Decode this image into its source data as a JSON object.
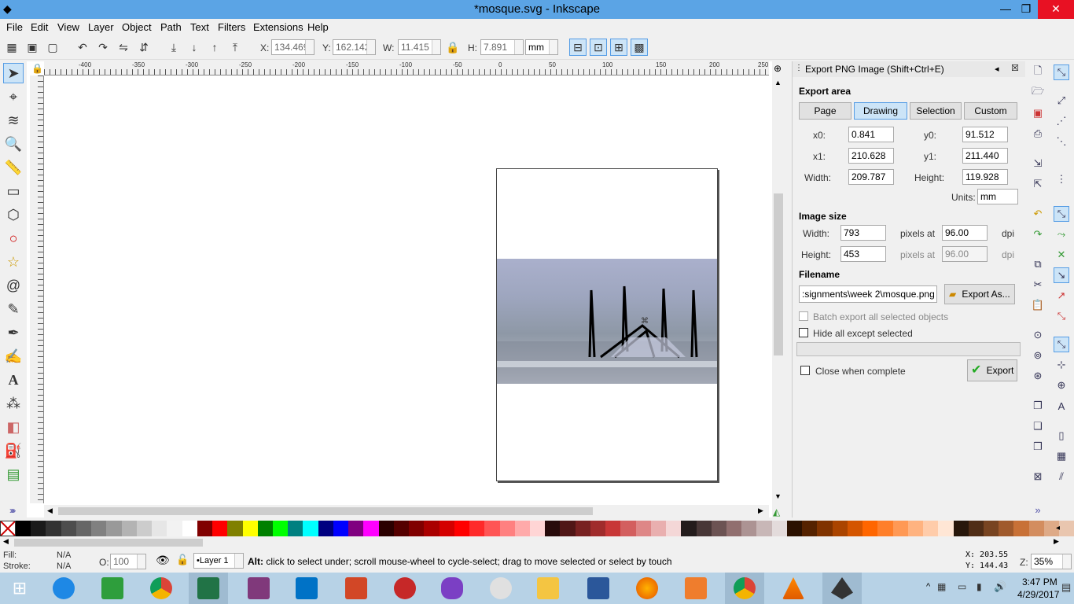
{
  "window": {
    "title": "*mosque.svg - Inkscape",
    "minimize": "—",
    "maximize": "❐",
    "close": "✕"
  },
  "menu": [
    "File",
    "Edit",
    "View",
    "Layer",
    "Object",
    "Path",
    "Text",
    "Filters",
    "Extensions",
    "Help"
  ],
  "toolbar": {
    "x_label": "X:",
    "x_value": "134.469",
    "y_label": "Y:",
    "y_value": "162.142",
    "w_label": "W:",
    "w_value": "11.415",
    "h_label": "H:",
    "h_value": "7.891",
    "unit": "mm"
  },
  "ruler": {
    "labels": [
      "-400",
      "-350",
      "-300",
      "-250",
      "-200",
      "-150",
      "-100",
      "-50",
      "0",
      "50",
      "100",
      "150",
      "200",
      "250"
    ]
  },
  "dialog": {
    "title": "Export PNG Image (Shift+Ctrl+E)",
    "export_area_label": "Export area",
    "area_buttons": [
      "Page",
      "Drawing",
      "Selection",
      "Custom"
    ],
    "active_area": "Drawing",
    "x0_label": "x0:",
    "x0": "0.841",
    "y0_label": "y0:",
    "y0": "91.512",
    "x1_label": "x1:",
    "x1": "210.628",
    "y1_label": "y1:",
    "y1": "211.440",
    "width_label": "Width:",
    "width": "209.787",
    "height_label": "Height:",
    "height": "119.928",
    "units_label": "Units:",
    "units": "mm",
    "image_size_label": "Image size",
    "img_width_label": "Width:",
    "img_width": "793",
    "img_height_label": "Height:",
    "img_height": "453",
    "pixels_at": "pixels at",
    "dpi_value": "96.00",
    "dpi_value2": "96.00",
    "dpi": "dpi",
    "filename_label": "Filename",
    "filename": ":signments\\week 2\\mosque.png",
    "export_as": "Export As...",
    "batch_export": "Batch export all selected objects",
    "hide_all": "Hide all except selected",
    "close_when_complete": "Close when complete",
    "export": "Export"
  },
  "status": {
    "fill_label": "Fill:",
    "fill_value": "N/A",
    "stroke_label": "Stroke:",
    "stroke_value": "N/A",
    "opacity_label": "O:",
    "opacity_value": "100",
    "layer": "•Layer 1",
    "message": "Alt: click to select under; scroll mouse-wheel to cycle-select; drag to move selected or select by touch",
    "x_coord": "X:  203.55",
    "y_coord": "Y:  144.43",
    "zoom_label": "Z:",
    "zoom": "35%"
  },
  "taskbar": {
    "time": "3:47 PM",
    "date": "4/29/2017"
  },
  "palette_colors": [
    "#000000",
    "#1a1a1a",
    "#333333",
    "#4d4d4d",
    "#666666",
    "#808080",
    "#999999",
    "#b3b3b3",
    "#cccccc",
    "#e6e6e6",
    "#f2f2f2",
    "#ffffff",
    "#800000",
    "#ff0000",
    "#808000",
    "#ffff00",
    "#008000",
    "#00ff00",
    "#008080",
    "#00ffff",
    "#000080",
    "#0000ff",
    "#800080",
    "#ff00ff",
    "#2b0000",
    "#550000",
    "#800000",
    "#aa0000",
    "#d40000",
    "#ff0000",
    "#ff2a2a",
    "#ff5555",
    "#ff8080",
    "#ffaaaa",
    "#ffd5d5",
    "#280b0b",
    "#501616",
    "#782121",
    "#a02c2c",
    "#c83737",
    "#d35f5f",
    "#de8787",
    "#e9afaf",
    "#f4d7d7",
    "#241c1c",
    "#483737",
    "#6c5353",
    "#916f6f",
    "#ac9393",
    "#c8b7b7",
    "#e3dbdb",
    "#2b1100",
    "#552200",
    "#803300",
    "#aa4400",
    "#d45500",
    "#ff6600",
    "#ff7f2a",
    "#ff9955",
    "#ffb380",
    "#ffccaa",
    "#ffe6d5",
    "#28170b",
    "#502d16",
    "#784421",
    "#a05a2c",
    "#c87137",
    "#d38d5f",
    "#deaa87",
    "#e9c6af"
  ]
}
